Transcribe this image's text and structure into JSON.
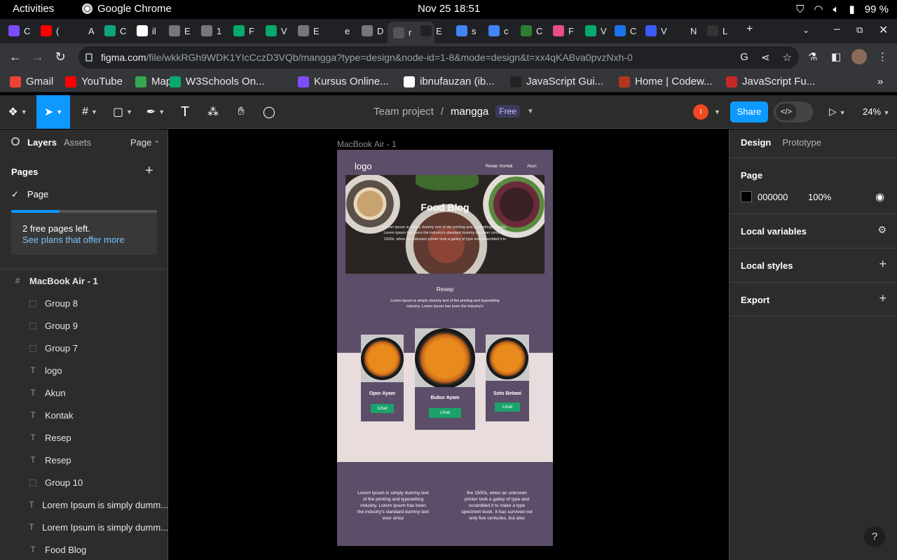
{
  "system": {
    "activities": "Activities",
    "app_name": "Google Chrome",
    "clock": "Nov 25  18:51",
    "battery": "99 %"
  },
  "browser": {
    "tabs": [
      {
        "label": "C",
        "color": "#7c4dff"
      },
      {
        "label": "(",
        "color": "#ff0000"
      },
      {
        "label": "A",
        "color": "#222222"
      },
      {
        "label": "C",
        "color": "#10a37f"
      },
      {
        "label": "il",
        "color": "#ffffff"
      },
      {
        "label": "E",
        "color": "#777777"
      },
      {
        "label": "1",
        "color": "#777777"
      },
      {
        "label": "F",
        "color": "#04aa6d"
      },
      {
        "label": "V",
        "color": "#04aa6d"
      },
      {
        "label": "E",
        "color": "#777777"
      },
      {
        "label": "e",
        "color": "#222222"
      },
      {
        "label": "D",
        "color": "#777777"
      },
      {
        "label": "r",
        "color": "#555555"
      },
      {
        "label": "E",
        "color": "#202124"
      },
      {
        "label": "s",
        "color": "#4285f4"
      },
      {
        "label": "c",
        "color": "#4285f4"
      },
      {
        "label": "C",
        "color": "#2e7d32"
      },
      {
        "label": "F",
        "color": "#ea4c89"
      },
      {
        "label": "V",
        "color": "#04aa6d"
      },
      {
        "label": "C",
        "color": "#1a73e8"
      },
      {
        "label": "V",
        "color": "#3d5afe"
      },
      {
        "label": "N",
        "color": "#222222"
      },
      {
        "label": "L",
        "color": "#333333"
      }
    ],
    "url_host": "figma.com",
    "url_path": "/file/wkkRGh9WDK1YIcCczD3VQb/mangga?type=design&node-id=1-8&mode=design&t=xx4qKABva0pvzNxh-0",
    "bookmarks": [
      {
        "label": "Gmail",
        "color": "#ea4335"
      },
      {
        "label": "YouTube",
        "color": "#ff0000"
      },
      {
        "label": "Maps",
        "color": "#34a853"
      },
      {
        "label": "W3Schools On...",
        "color": "#04aa6d"
      },
      {
        "label": "Kursus Online...",
        "color": "#7c4dff"
      },
      {
        "label": "ibnufauzan (ib...",
        "color": "#ffffff"
      },
      {
        "label": "JavaScript Gui...",
        "color": "#222222"
      },
      {
        "label": "Home | Codew...",
        "color": "#b1361e"
      },
      {
        "label": "JavaScript Fu...",
        "color": "#c62828"
      }
    ]
  },
  "figma": {
    "project": "Team project",
    "file_name": "mangga",
    "plan_badge": "Free",
    "avatar_letter": "I",
    "share": "Share",
    "zoom": "24%",
    "left_panel": {
      "tab_layers": "Layers",
      "tab_assets": "Assets",
      "page_selector": "Page",
      "pages_title": "Pages",
      "current_page": "Page",
      "promo_line1": "2 free pages left.",
      "promo_line2": "See plans that offer more",
      "promo_progress": 0.33,
      "layers": [
        {
          "name": "MacBook Air - 1",
          "type": "frame"
        },
        {
          "name": "Group 8",
          "type": "group"
        },
        {
          "name": "Group 9",
          "type": "group"
        },
        {
          "name": "Group 7",
          "type": "group"
        },
        {
          "name": "logo",
          "type": "text"
        },
        {
          "name": "Akun",
          "type": "text"
        },
        {
          "name": "Kontak",
          "type": "text"
        },
        {
          "name": "Resep",
          "type": "text"
        },
        {
          "name": "Resep",
          "type": "text"
        },
        {
          "name": "Group 10",
          "type": "group"
        },
        {
          "name": "Lorem Ipsum is simply dumm...",
          "type": "text"
        },
        {
          "name": "Lorem Ipsum is simply dumm...",
          "type": "text"
        },
        {
          "name": "Food Blog",
          "type": "text"
        }
      ]
    },
    "right_panel": {
      "tab_design": "Design",
      "tab_prototype": "Prototype",
      "page_section": "Page",
      "bg_hex": "000000",
      "bg_opacity": "100%",
      "local_variables": "Local variables",
      "local_styles": "Local styles",
      "export": "Export"
    },
    "canvas": {
      "frame_label": "MacBook Air - 1",
      "logo": "logo",
      "nav": [
        "Resep",
        "Kontak",
        "Akun"
      ],
      "hero_title": "Food Blog",
      "hero_text": "Lorem Ipsum is simply dummy text of the printing and typesetting industry. Lorem Ipsum has been the industry's standard dummy text ever since the 1500s, when an unknown printer took a galley of type and scrambled it to",
      "section_title": "Resep",
      "section_text": "Lorem Ipsum is simply dummy text of the printing and typesetting industry. Lorem Ipsum has been the industry's",
      "cards": [
        {
          "name": "Opor Ayam",
          "button": "Lihat"
        },
        {
          "name": "Bubur Ayam",
          "button": "Lihat"
        },
        {
          "name": "Soto Betawi",
          "button": "Lihat"
        }
      ],
      "footer_left": "Lorem Ipsum is simply dummy text of the printing and typesetting industry. Lorem Ipsum has been the industry's standard dummy text ever since",
      "footer_right": "the 1500s, when an unknown printer took a galley of type and scrambled it to make a type specimen book. It has survived not only five centuries, but also"
    }
  },
  "colors": {
    "figma_blue": "#0d99ff",
    "frame_purple": "#5c4d68",
    "button_green": "#1ba36b",
    "light_band": "#e8dcdc"
  },
  "help_label": "?"
}
